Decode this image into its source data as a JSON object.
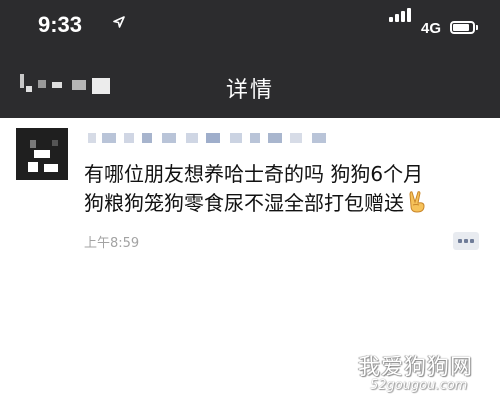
{
  "status_bar": {
    "time": "9:33",
    "network": "4G",
    "icons": [
      "location-arrow-icon",
      "signal-bars-icon",
      "battery-icon"
    ]
  },
  "nav": {
    "title": "详情"
  },
  "post": {
    "line1": "有哪位朋友想养哈士奇的吗 狗狗6个月",
    "line2": "狗粮狗笼狗零食尿不湿全部打包赠送",
    "emoji": "victory-hand-icon",
    "timestamp": "上午8:59"
  },
  "watermark": {
    "title": "我爱狗狗网",
    "url": "52gougou.com"
  },
  "colors": {
    "bar_background": "#2c2c2e",
    "link_blue": "#b9c4d8",
    "timestamp_gray": "#a3a3a3"
  }
}
